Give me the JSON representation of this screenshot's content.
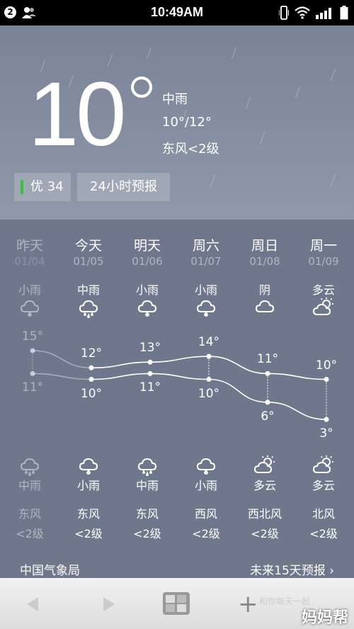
{
  "status": {
    "badge": "2",
    "time": "10:49AM"
  },
  "current": {
    "temp": "10",
    "condition": "中雨",
    "range": "10°/12°",
    "wind": "东风<2级",
    "aqi_label": "优 34",
    "hourly_button": "24小时预报"
  },
  "days": [
    {
      "name": "昨天",
      "date": "01/04",
      "cond_day": "小雨",
      "icon_day": "light-rain-icon",
      "high": "15°",
      "low": "11°",
      "icon_night": "moderate-rain-icon",
      "cond_night": "中雨",
      "wind_dir": "东风",
      "wind_lvl": "<2级",
      "past": true
    },
    {
      "name": "今天",
      "date": "01/05",
      "cond_day": "中雨",
      "icon_day": "moderate-rain-icon",
      "high": "12°",
      "low": "10°",
      "icon_night": "light-rain-icon",
      "cond_night": "小雨",
      "wind_dir": "东风",
      "wind_lvl": "<2级",
      "past": false
    },
    {
      "name": "明天",
      "date": "01/06",
      "cond_day": "小雨",
      "icon_day": "light-rain-icon",
      "high": "13°",
      "low": "11°",
      "icon_night": "moderate-rain-icon",
      "cond_night": "中雨",
      "wind_dir": "东风",
      "wind_lvl": "<2级",
      "past": false
    },
    {
      "name": "周六",
      "date": "01/07",
      "cond_day": "小雨",
      "icon_day": "light-rain-icon",
      "high": "14°",
      "low": "10°",
      "icon_night": "light-rain-icon",
      "cond_night": "小雨",
      "wind_dir": "西风",
      "wind_lvl": "<2级",
      "past": false
    },
    {
      "name": "周日",
      "date": "01/08",
      "cond_day": "阴",
      "icon_day": "overcast-icon",
      "high": "11°",
      "low": "6°",
      "icon_night": "partly-cloudy-night-icon",
      "cond_night": "多云",
      "wind_dir": "西北风",
      "wind_lvl": "<2级",
      "past": false
    },
    {
      "name": "周一",
      "date": "01/09",
      "cond_day": "多云",
      "icon_day": "partly-cloudy-icon",
      "high": "10°",
      "low": "3°",
      "icon_night": "partly-cloudy-night-icon",
      "cond_night": "多云",
      "wind_dir": "北风",
      "wind_lvl": "<2级",
      "past": false
    }
  ],
  "temps": {
    "high": [
      15,
      12,
      13,
      14,
      11,
      10
    ],
    "low": [
      11,
      10,
      11,
      10,
      6,
      3
    ]
  },
  "footer": {
    "source": "中国气象局",
    "forecast15": "未来15天预报 ›"
  },
  "navbar": {
    "watermark": "妈妈帮",
    "watermark_small": "和你每天一起"
  },
  "colors": {
    "aqi": "#37c43b"
  }
}
